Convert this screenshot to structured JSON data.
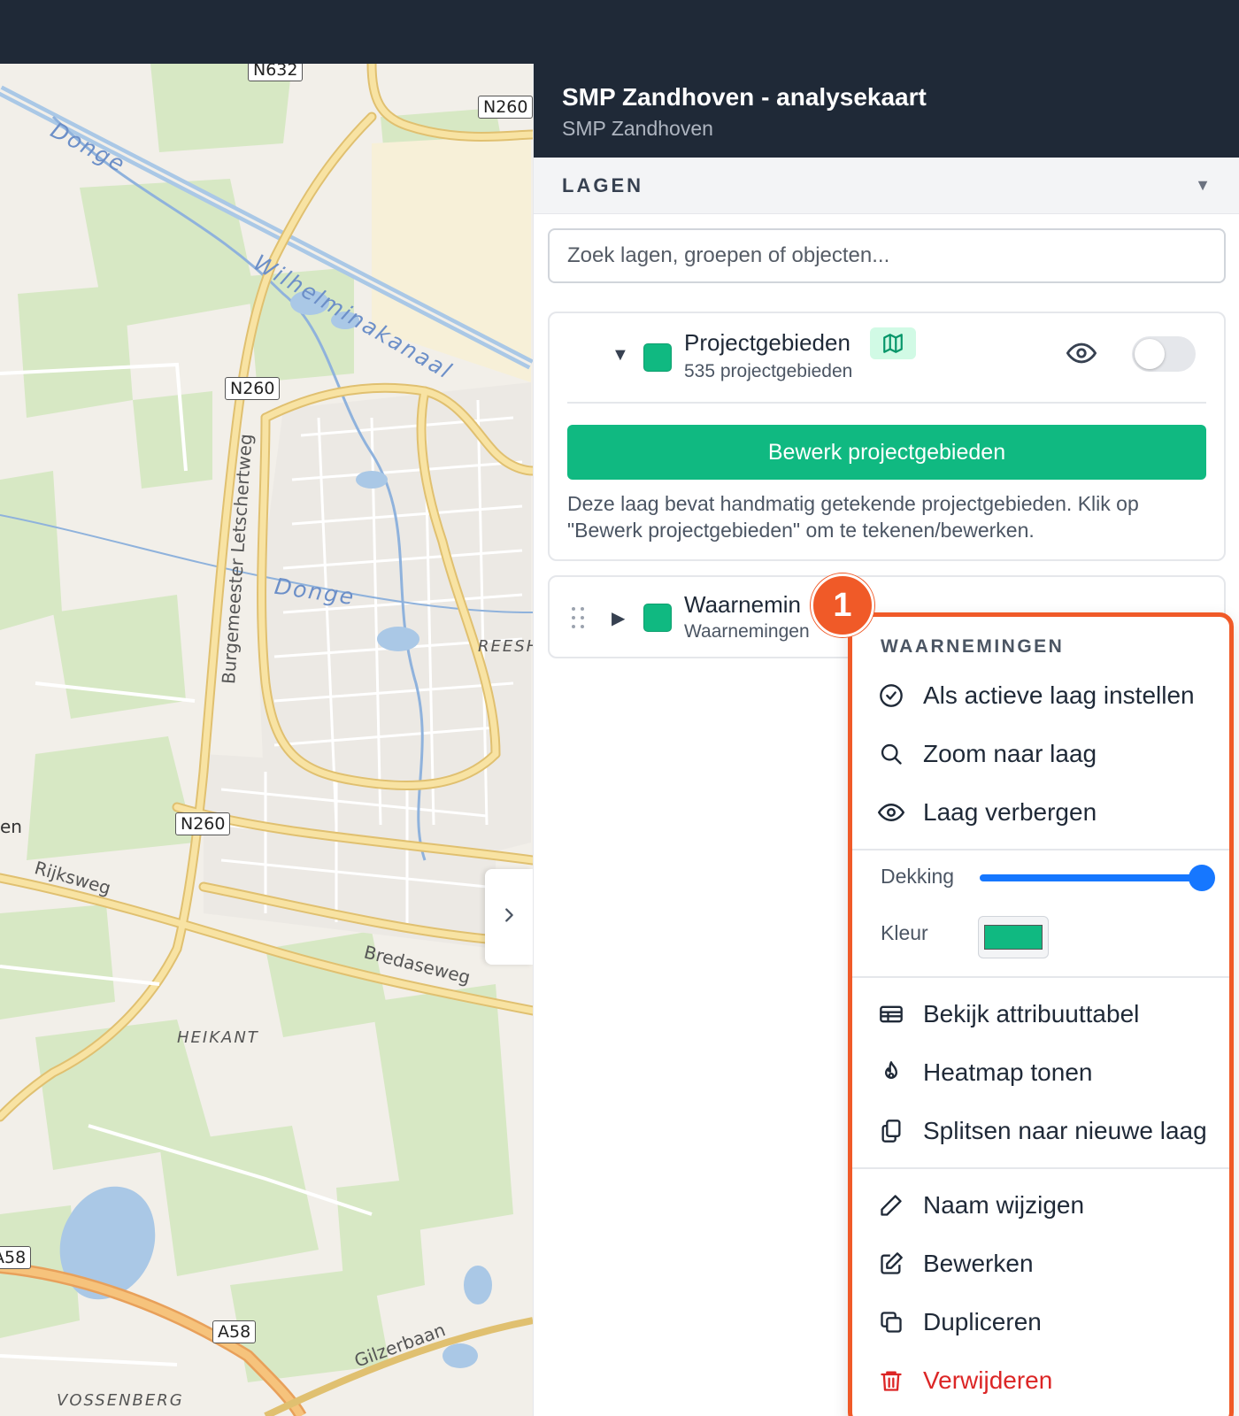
{
  "panel": {
    "title": "SMP Zandhoven - analysekaart",
    "subtitle": "SMP Zandhoven"
  },
  "layers_section": {
    "title": "LAGEN",
    "search_placeholder": "Zoek lagen, groepen of objecten..."
  },
  "layers": [
    {
      "name": "Projectgebieden",
      "count": "535 projectgebieden",
      "color": "#10b981",
      "badge_icon": "map-icon",
      "expanded": true,
      "edit_button": "Bewerk projectgebieden",
      "description": "Deze laag bevat handmatig getekende projectgebieden. Klik op \"Bewerk projectgebieden\" om te tekenen/bewerken."
    },
    {
      "name": "Waarnemin",
      "count": "Waarnemingen",
      "color": "#10b981",
      "expanded": false
    }
  ],
  "annotation": {
    "step": "1",
    "color": "#f05a28"
  },
  "context_menu": {
    "heading": "WAARNEMINGEN",
    "group1": [
      {
        "label": "Als actieve laag instellen",
        "icon": "check-circle-icon"
      },
      {
        "label": "Zoom naar laag",
        "icon": "search-icon"
      },
      {
        "label": "Laag verbergen",
        "icon": "eye-icon"
      }
    ],
    "opacity_label": "Dekking",
    "opacity_value": 1.0,
    "color_label": "Kleur",
    "color_value": "#10b981",
    "group2": [
      {
        "label": "Bekijk attribuuttabel",
        "icon": "table-icon"
      },
      {
        "label": "Heatmap tonen",
        "icon": "flame-icon"
      },
      {
        "label": "Splitsen naar nieuwe laag",
        "icon": "copy-split-icon"
      }
    ],
    "group3": [
      {
        "label": "Naam wijzigen",
        "icon": "pencil-icon"
      },
      {
        "label": "Bewerken",
        "icon": "edit-square-icon"
      },
      {
        "label": "Dupliceren",
        "icon": "duplicate-icon"
      },
      {
        "label": "Verwijderen",
        "icon": "trash-icon"
      }
    ]
  },
  "map": {
    "road_shields": [
      "N632",
      "N260",
      "N260",
      "N260",
      "A58",
      "A58"
    ],
    "water_labels": [
      "Donge",
      "Wilhelminakanaal",
      "Donge"
    ],
    "road_labels": [
      "Burgemeester Letschertweg",
      "Rijksweg",
      "Bredaseweg",
      "Gilzerbaan"
    ],
    "place_labels": [
      "HEIKANT",
      "VOSSENBERG",
      "REESH"
    ],
    "partial_labels": [
      "en"
    ]
  }
}
